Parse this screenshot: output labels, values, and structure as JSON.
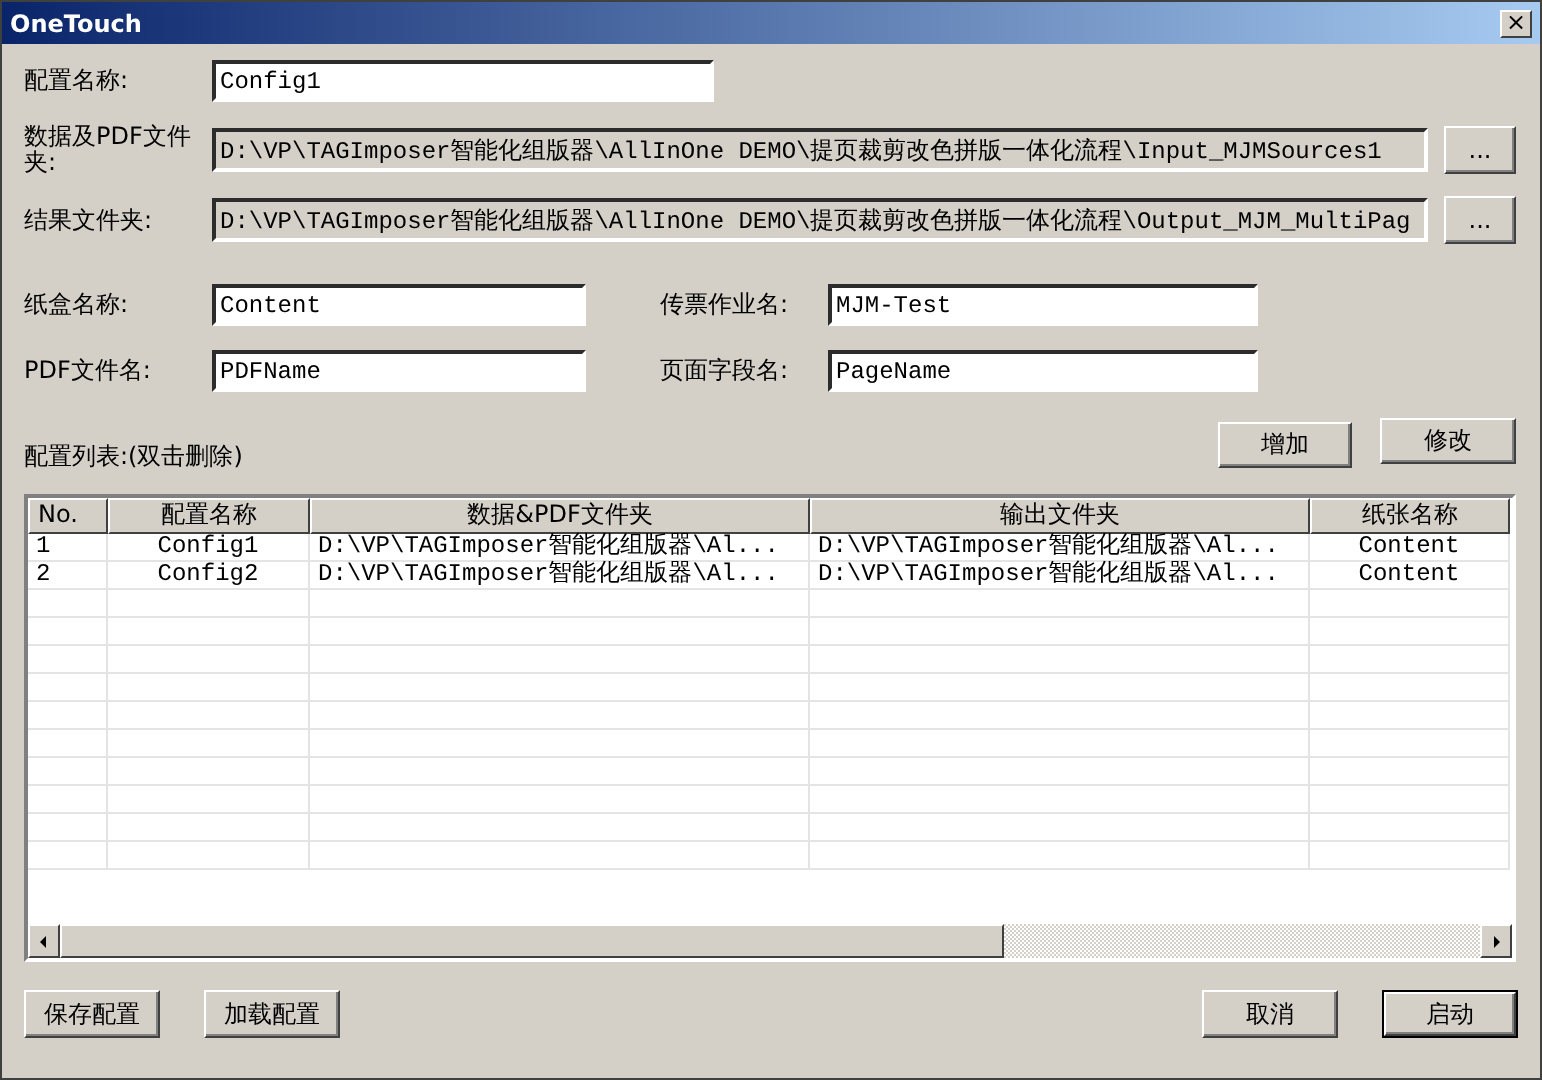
{
  "window": {
    "title": "OneTouch",
    "close": "×"
  },
  "config_name": {
    "label": "配置名称:",
    "value": "Config1"
  },
  "paths": [
    {
      "label": "数据及PDF文件夹:",
      "value": "D:\\VP\\TAGImposer智能化组版器\\AllInOne DEMO\\提页裁剪改色拼版一体化流程\\Input_MJMSources1",
      "button": "..."
    },
    {
      "label": "结果文件夹:",
      "value": "D:\\VP\\TAGImposer智能化组版器\\AllInOne DEMO\\提页裁剪改色拼版一体化流程\\Output_MJM_MultiPag",
      "button": "..."
    }
  ],
  "fields": [
    {
      "label": "纸盒名称:",
      "value": "Content"
    },
    {
      "label": "传票作业名:",
      "value": "MJM-Test"
    },
    {
      "label": "PDF文件名:",
      "value": "PDFName"
    },
    {
      "label": "页面字段名:",
      "value": "PageName"
    }
  ],
  "list_label": "配置列表:(双击删除)",
  "list_buttons": [
    "增加",
    "修改"
  ],
  "table": {
    "columns": [
      "No.",
      "配置名称",
      "数据&PDF文件夹",
      "输出文件夹",
      "纸张名称"
    ],
    "rows": [
      [
        "1",
        "Config1",
        "D:\\VP\\TAGImposer智能化组版器\\Al...",
        "D:\\VP\\TAGImposer智能化组版器\\Al...",
        "Content"
      ],
      [
        "2",
        "Config2",
        "D:\\VP\\TAGImposer智能化组版器\\Al...",
        "D:\\VP\\TAGImposer智能化组版器\\Al...",
        "Content"
      ]
    ]
  },
  "bottom_left": [
    "保存配置",
    "加载配置"
  ],
  "bottom_right": [
    {
      "label": "取消",
      "default": false
    },
    {
      "label": "启动",
      "default": true
    }
  ]
}
